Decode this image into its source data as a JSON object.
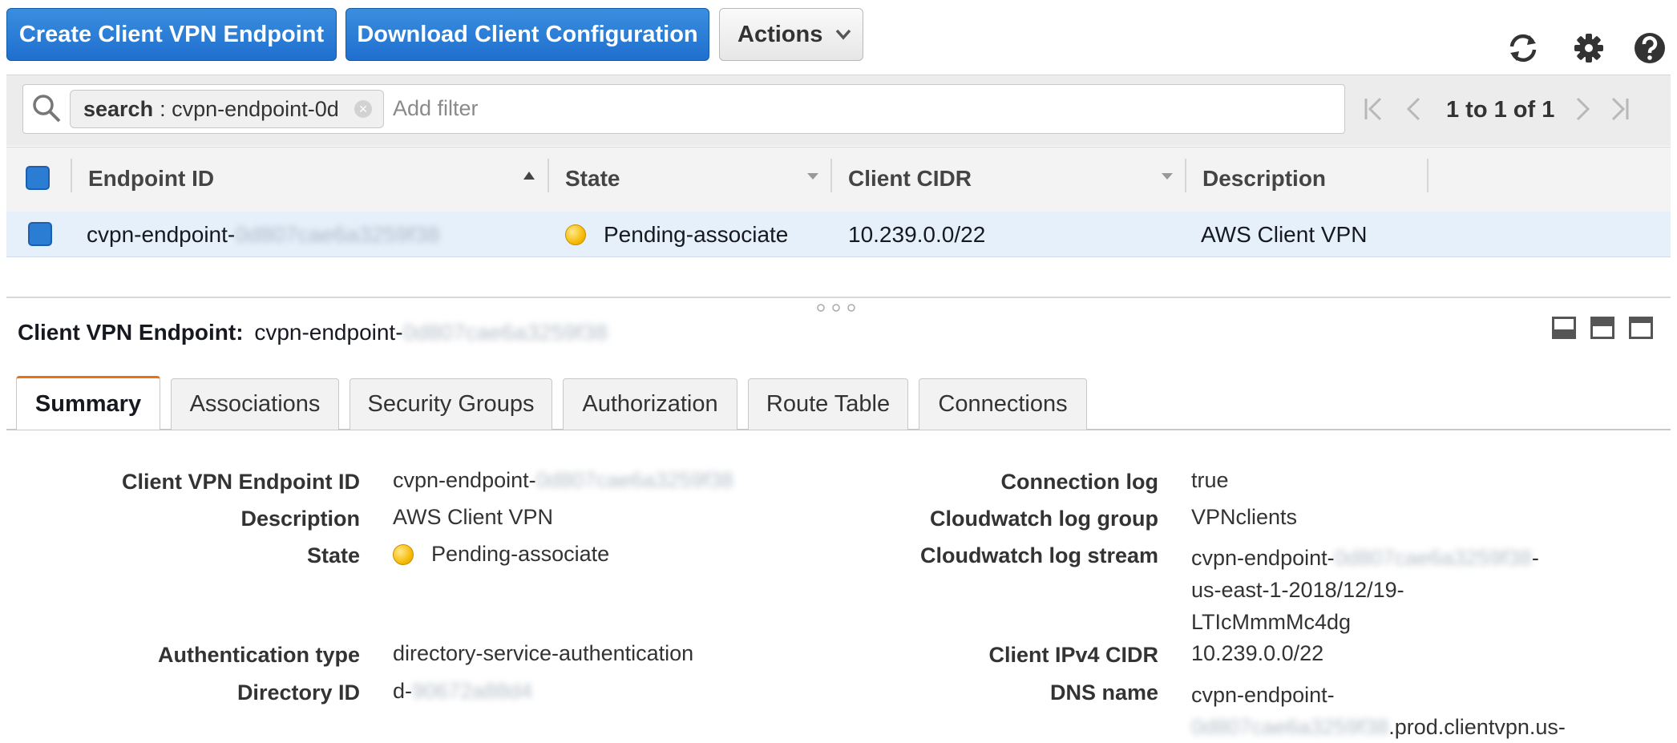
{
  "toolbar": {
    "create_label": "Create Client VPN Endpoint",
    "download_label": "Download Client Configuration",
    "actions_label": "Actions",
    "icons": [
      "refresh-icon",
      "gear-icon",
      "help-icon"
    ]
  },
  "filter": {
    "chip_key": "search",
    "chip_value": ": cvpn-endpoint-0d",
    "placeholder": "Add filter",
    "pager_text": "1 to 1 of 1"
  },
  "table": {
    "headers": [
      "Endpoint ID",
      "State",
      "Client CIDR",
      "Description"
    ],
    "rows": [
      {
        "endpoint_prefix": "cvpn-endpoint-",
        "endpoint_masked": "0d807cae6a3259f38",
        "state": "Pending-associate",
        "client_cidr": "10.239.0.0/22",
        "description": "AWS Client VPN"
      }
    ]
  },
  "detail": {
    "title_label": "Client VPN Endpoint:",
    "title_prefix": "cvpn-endpoint-",
    "title_masked": "0d807cae6a3259f38",
    "tabs": [
      "Summary",
      "Associations",
      "Security Groups",
      "Authorization",
      "Route Table",
      "Connections"
    ],
    "left": {
      "endpoint_id_label": "Client VPN Endpoint ID",
      "endpoint_id_prefix": "cvpn-endpoint-",
      "endpoint_id_masked": "0d807cae6a3259f38",
      "description_label": "Description",
      "description_value": "AWS Client VPN",
      "state_label": "State",
      "state_value": "Pending-associate",
      "auth_label": "Authentication type",
      "auth_value": "directory-service-authentication",
      "directory_label": "Directory ID",
      "directory_prefix": "d-",
      "directory_masked": "90672a88d4"
    },
    "right": {
      "connlog_label": "Connection log",
      "connlog_value": "true",
      "cwgroup_label": "Cloudwatch log group",
      "cwgroup_value": "VPNclients",
      "cwstream_label": "Cloudwatch log stream",
      "cwstream_prefix": "cvpn-endpoint-",
      "cwstream_masked": "0d807cae6a3259f38",
      "cwstream_suffix": "-",
      "cwstream_line2": "us-east-1-2018/12/19-",
      "cwstream_line3": "LTIcMmmMc4dg",
      "cidr_label": "Client IPv4 CIDR",
      "cidr_value": "10.239.0.0/22",
      "dns_label": "DNS name",
      "dns_line1": "cvpn-endpoint-",
      "dns_masked": "0d807cae6a3259f38",
      "dns_suffix": ".prod.clientvpn.us-"
    }
  },
  "colors": {
    "primary_button": "#1f6fcf",
    "selected_row": "#e6f0fb",
    "active_tab_accent": "#ec7211",
    "pending_state": "#f5b800"
  }
}
